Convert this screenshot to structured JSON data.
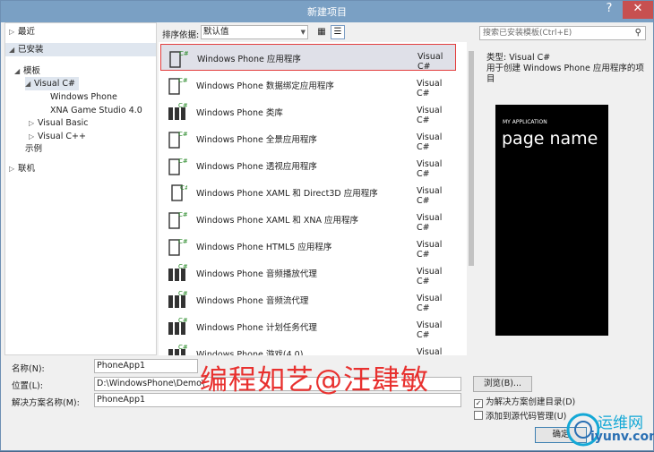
{
  "window": {
    "title": "新建项目",
    "help_icon": "?",
    "close_icon": "✕"
  },
  "tree": {
    "recent": "最近",
    "installed": "已安装",
    "templates": "模板",
    "visual_csharp": "Visual C#",
    "windows_phone": "Windows Phone",
    "xna": "XNA Game Studio 4.0",
    "visual_basic": "Visual Basic",
    "visual_cpp": "Visual C++",
    "examples": "示例",
    "online": "联机"
  },
  "toolbar": {
    "sort_label": "排序依据:",
    "sort_value": "默认值"
  },
  "search": {
    "placeholder": "搜索已安装模板(Ctrl+E)"
  },
  "templates": [
    {
      "name": "Windows Phone 应用程序",
      "lang": "Visual C#"
    },
    {
      "name": "Windows Phone 数据绑定应用程序",
      "lang": "Visual C#"
    },
    {
      "name": "Windows Phone 类库",
      "lang": "Visual C#"
    },
    {
      "name": "Windows Phone 全景应用程序",
      "lang": "Visual C#"
    },
    {
      "name": "Windows Phone 透视应用程序",
      "lang": "Visual C#"
    },
    {
      "name": "Windows Phone XAML 和 Direct3D 应用程序",
      "lang": "Visual C#"
    },
    {
      "name": "Windows Phone XAML 和 XNA 应用程序",
      "lang": "Visual C#"
    },
    {
      "name": "Windows Phone HTML5 应用程序",
      "lang": "Visual C#"
    },
    {
      "name": "Windows Phone 音频播放代理",
      "lang": "Visual C#"
    },
    {
      "name": "Windows Phone 音频流代理",
      "lang": "Visual C#"
    },
    {
      "name": "Windows Phone 计划任务代理",
      "lang": "Visual C#"
    },
    {
      "name": "Windows Phone 游戏(4.0)",
      "lang": "Visual C#"
    }
  ],
  "info": {
    "type": "类型:  Visual C#",
    "description": "用于创建 Windows Phone 应用程序的项目",
    "preview_app": "MY APPLICATION",
    "preview_page": "page name"
  },
  "form": {
    "name_label": "名称(N):",
    "name_value": "PhoneApp1",
    "location_label": "位置(L):",
    "location_value": "D:\\WindowsPhone\\Demo\\",
    "solution_label": "解决方案名称(M):",
    "solution_value": "PhoneApp1",
    "browse": "浏览(B)...",
    "create_dir": "为解决方案创建目录(D)",
    "add_scc": "添加到源代码管理(U)",
    "ok": "确定"
  },
  "watermark": "编程如艺@汪肆敏",
  "logo": {
    "title": "运维网",
    "url": "iyunv.com"
  }
}
